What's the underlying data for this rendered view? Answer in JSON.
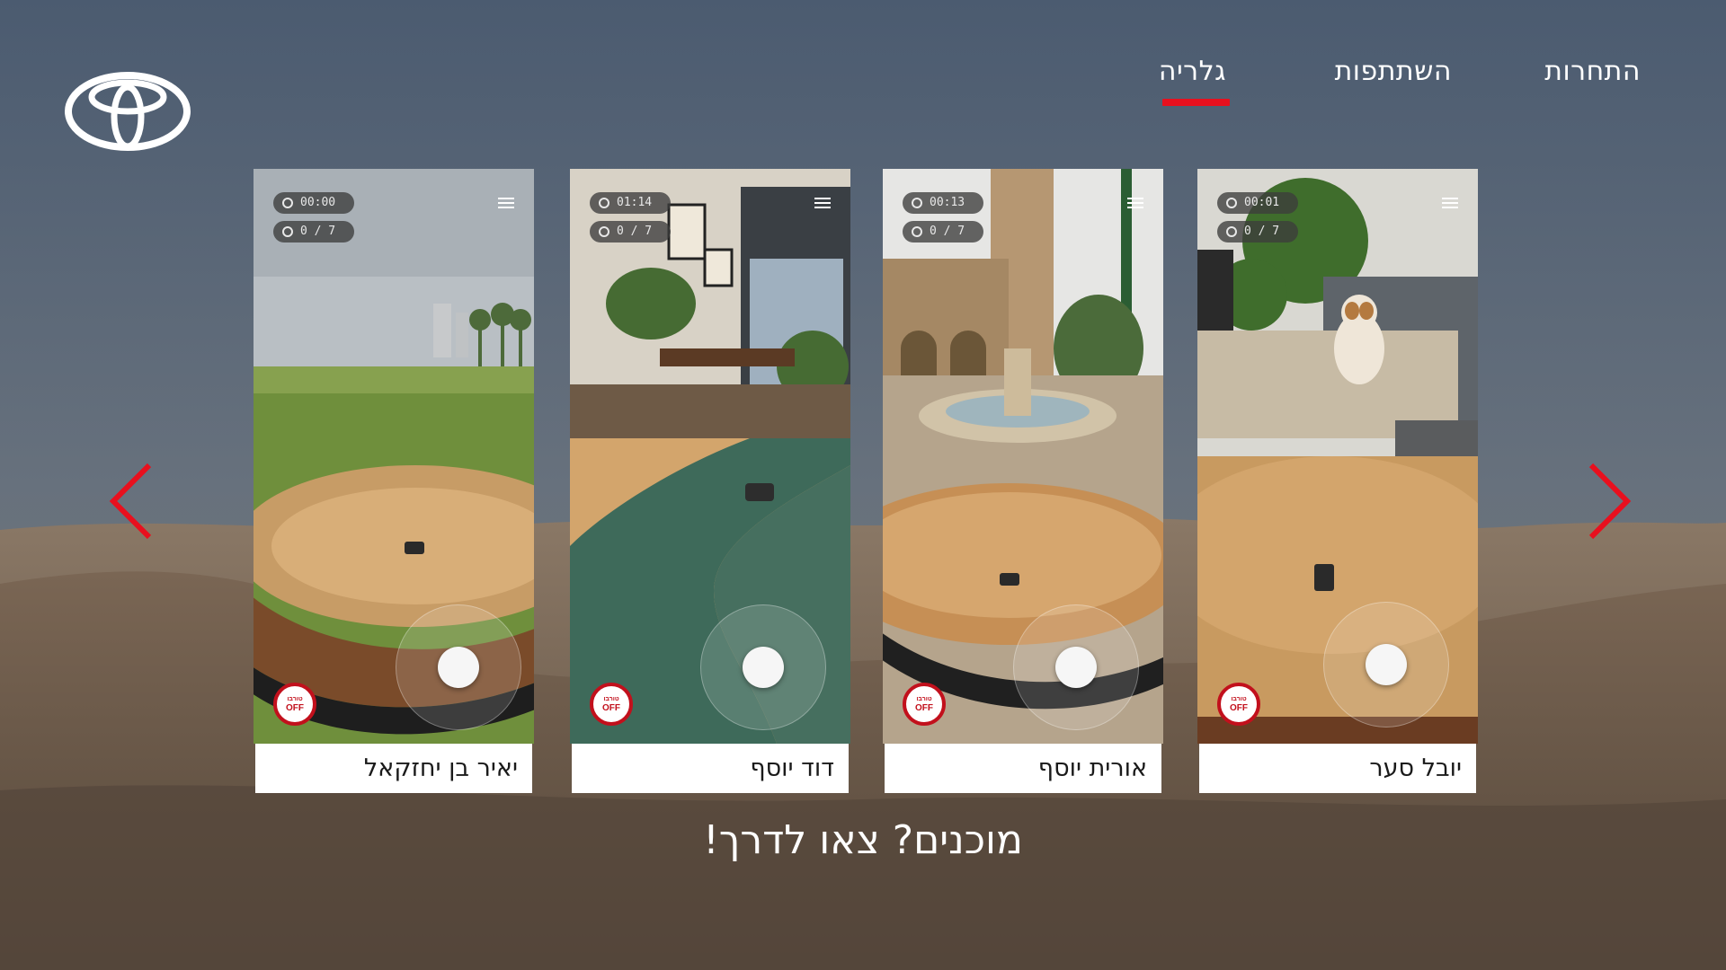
{
  "brand": {
    "logo_icon": "toyota-logo",
    "accent_color": "#e8101e"
  },
  "nav": {
    "items": [
      {
        "label": "התחרות",
        "active": false
      },
      {
        "label": "השתתפות",
        "active": false
      },
      {
        "label": "גלריה",
        "active": true
      }
    ]
  },
  "gallery": {
    "prev_icon": "chevron-left-icon",
    "next_icon": "chevron-right-icon",
    "cards": [
      {
        "name": "יאיר בן יחזקאל",
        "timer": "00:00",
        "score": "0 / 7",
        "scene": "park"
      },
      {
        "name": "דוד יוסף",
        "timer": "01:14",
        "score": "0 / 7",
        "scene": "living-room-water"
      },
      {
        "name": "אורית יוסף",
        "timer": "00:13",
        "score": "0 / 7",
        "scene": "plaza-fountain"
      },
      {
        "name": "יובל סער",
        "timer": "00:01",
        "score": "0 / 7",
        "scene": "sofa-dog"
      }
    ],
    "turbo_label_he": "טורבו",
    "turbo_label": "OFF"
  },
  "tagline": "מוכנים? צאו לדרך!"
}
